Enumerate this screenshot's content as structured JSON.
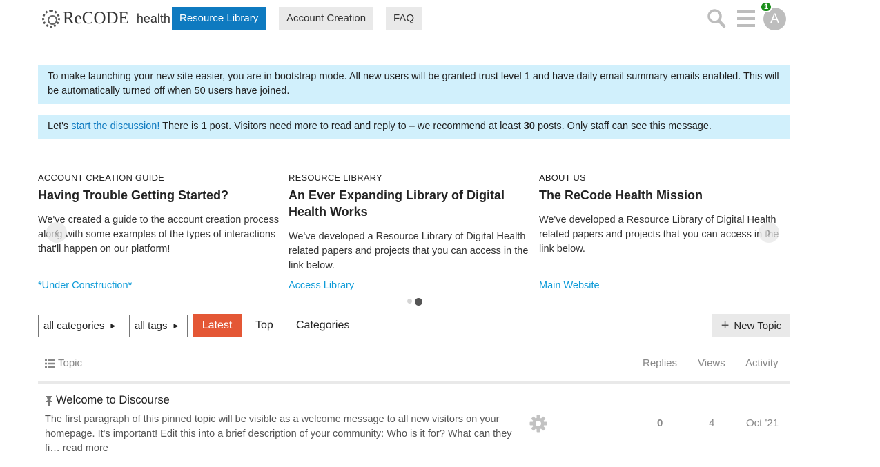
{
  "header": {
    "logo_main": "ReCODE",
    "logo_sub": "health",
    "nav": [
      "Resource Library",
      "Account Creation",
      "FAQ"
    ],
    "notification_count": "1",
    "avatar_letter": "A"
  },
  "notices": {
    "bootstrap": "To make launching your new site easier, you are in bootstrap mode. All new users will be granted trust level 1 and have daily email summary emails enabled. This will be automatically turned off when 50 users have joined.",
    "discussion": {
      "prefix": "Let's ",
      "link": "start the discussion!",
      "middle1": " There is ",
      "post_count": "1",
      "middle2": " post. Visitors need more to read and reply to – we recommend at least ",
      "recommended": "30",
      "suffix": " posts. Only staff can see this message."
    }
  },
  "banner": {
    "cards": [
      {
        "kicker": "ACCOUNT CREATION GUIDE",
        "title": "Having Trouble Getting Started?",
        "body": "We've created a guide to the account creation process along with some examples of the types of interactions that'll happen on our platform!",
        "link": "*Under Construction*"
      },
      {
        "kicker": "RESOURCE LIBRARY",
        "title": "An Ever Expanding Library of Digital Health Works",
        "body": "We've developed a Resource Library of Digital Health related papers and projects that you can access in the link below.",
        "link": "Access Library"
      },
      {
        "kicker": "ABOUT US",
        "title": "The ReCode Health Mission",
        "body": "We've developed a Resource Library of Digital Health related papers and projects that you can access in the link below.",
        "link": "Main Website"
      }
    ],
    "prev_arrow": "‹",
    "next_arrow": "›"
  },
  "controls": {
    "categories": "all categories",
    "tags": "all tags",
    "tabs": [
      "Latest",
      "Top",
      "Categories"
    ],
    "new_topic": "New Topic"
  },
  "table": {
    "headers": {
      "topic": "Topic",
      "replies": "Replies",
      "views": "Views",
      "activity": "Activity"
    },
    "rows": [
      {
        "title": "Welcome to Discourse",
        "excerpt": "The first paragraph of this pinned topic will be visible as a welcome message to all new visitors on your homepage. It's important! Edit this into a brief description of your community: Who is it for? What can they fi…",
        "read_more": "read more",
        "replies": "0",
        "views": "4",
        "activity": "Oct '21"
      }
    ]
  },
  "colors": {
    "brand": "#0e7ac0",
    "latest": "#e45735",
    "notice_bg": "#d1f0fc",
    "badge": "#1a8f1a"
  }
}
